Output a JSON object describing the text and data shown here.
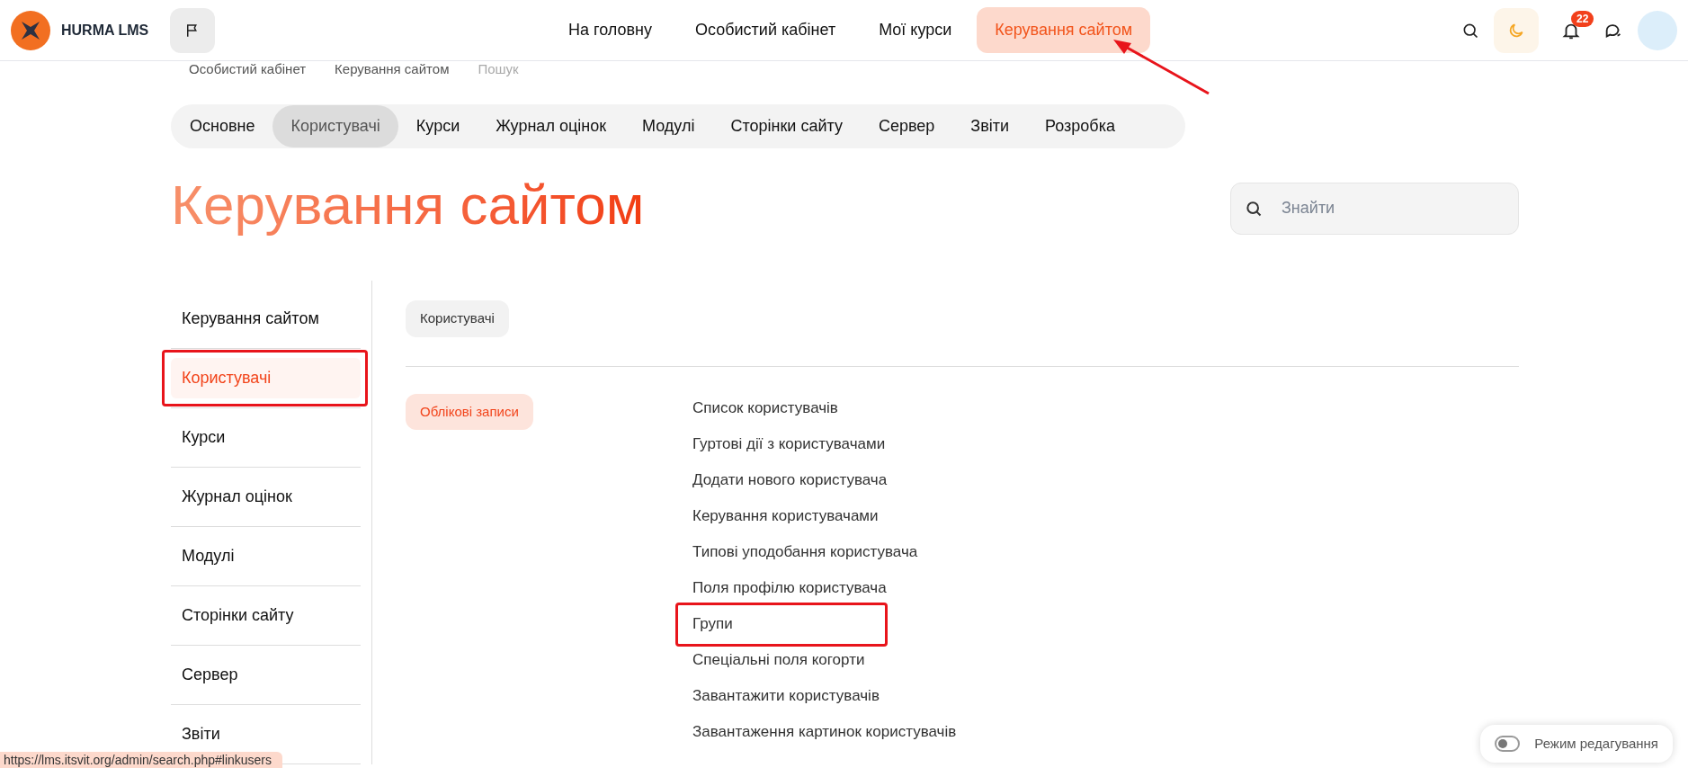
{
  "header": {
    "logo_text": "HURMA LMS",
    "nav": [
      {
        "label": "На головну",
        "selected": false,
        "pointed": false
      },
      {
        "label": "Особистий кабінет",
        "selected": false,
        "pointed": false
      },
      {
        "label": "Мої курси",
        "selected": false,
        "pointed": false
      },
      {
        "label": "Керування сайтом",
        "selected": true,
        "pointed": true
      }
    ],
    "notifications_badge": "22"
  },
  "breadcrumb": [
    "Особистий кабінет",
    "Керування сайтом",
    "Пошук"
  ],
  "tabs": [
    {
      "label": "Основне",
      "selected": false
    },
    {
      "label": "Користувачі",
      "selected": true
    },
    {
      "label": "Курси",
      "selected": false
    },
    {
      "label": "Журнал оцінок",
      "selected": false
    },
    {
      "label": "Модулі",
      "selected": false
    },
    {
      "label": "Сторінки сайту",
      "selected": false
    },
    {
      "label": "Сервер",
      "selected": false
    },
    {
      "label": "Звіти",
      "selected": false
    },
    {
      "label": "Розробка",
      "selected": false
    }
  ],
  "page_title": "Керування сайтом",
  "search": {
    "placeholder": "Знайти"
  },
  "sidebar": {
    "items": [
      {
        "label": "Керування сайтом",
        "selected": false,
        "highlighted": false
      },
      {
        "label": "Користувачі",
        "selected": true,
        "highlighted": true
      },
      {
        "label": "Курси",
        "selected": false,
        "highlighted": false
      },
      {
        "label": "Журнал оцінок",
        "selected": false,
        "highlighted": false
      },
      {
        "label": "Модулі",
        "selected": false,
        "highlighted": false
      },
      {
        "label": "Сторінки сайту",
        "selected": false,
        "highlighted": false
      },
      {
        "label": "Сервер",
        "selected": false,
        "highlighted": false
      },
      {
        "label": "Звіти",
        "selected": false,
        "highlighted": false
      }
    ]
  },
  "section_chip": "Користувачі",
  "category": {
    "label": "Облікові записи",
    "links": [
      {
        "label": "Список користувачів",
        "highlighted": false
      },
      {
        "label": "Гуртові дії з користувачами",
        "highlighted": false
      },
      {
        "label": "Додати нового користувача",
        "highlighted": false
      },
      {
        "label": "Керування користувачами",
        "highlighted": false
      },
      {
        "label": "Типові уподобання користувача",
        "highlighted": false
      },
      {
        "label": "Поля профілю користувача",
        "highlighted": false
      },
      {
        "label": "Групи",
        "highlighted": true
      },
      {
        "label": "Спеціальні поля когорти",
        "highlighted": false
      },
      {
        "label": "Завантажити користувачів",
        "highlighted": false
      },
      {
        "label": "Завантаження картинок користувачів",
        "highlighted": false
      }
    ]
  },
  "status_url": "https://lms.itsvit.org/admin/search.php#linkusers",
  "edit_mode": {
    "label": "Режим редагування",
    "on": false
  }
}
